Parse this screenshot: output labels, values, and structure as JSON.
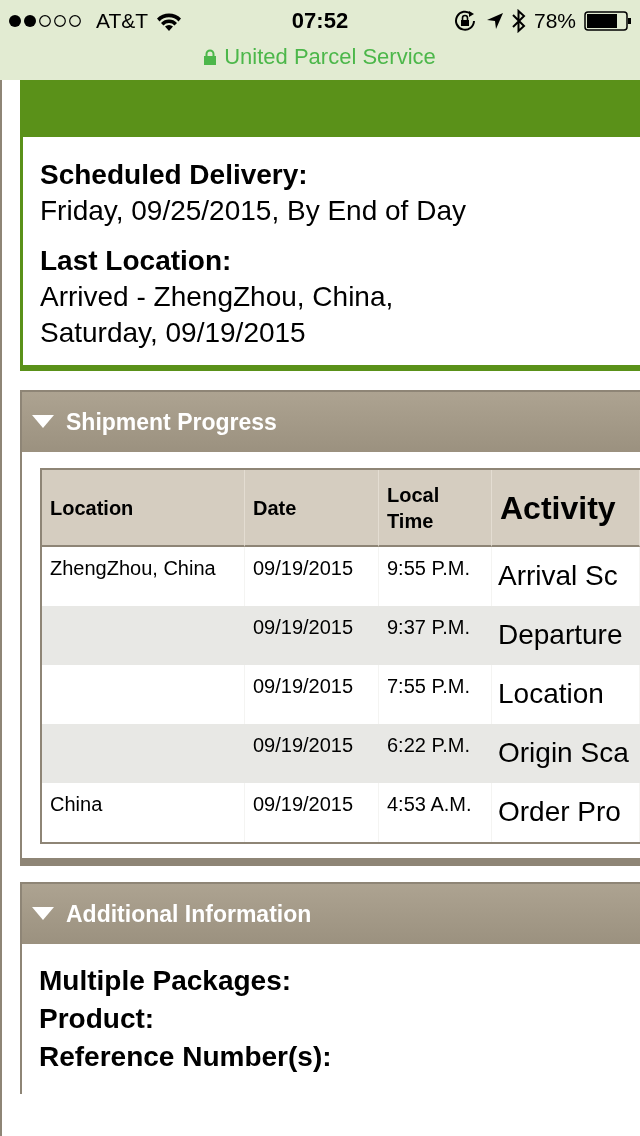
{
  "status_bar": {
    "carrier": "AT&T",
    "time": "07:52",
    "battery": "78%"
  },
  "address_bar": {
    "title": "United Parcel Service",
    "secure": true
  },
  "delivery": {
    "fields": [
      {
        "label": "Scheduled Delivery:",
        "lines": [
          "Friday, 09/25/2015, By End of Day"
        ]
      },
      {
        "label": "Last Location:",
        "lines": [
          "Arrived - ZhengZhou, China,",
          "Saturday, 09/19/2015"
        ]
      }
    ]
  },
  "shipment_progress": {
    "title": "Shipment Progress",
    "expanded": true,
    "columns": [
      "Location",
      "Date",
      "Local Time",
      "Activity"
    ],
    "rows": [
      {
        "location": "ZhengZhou, China",
        "date": "09/19/2015",
        "time": "9:55 P.M.",
        "activity": "Arrival Sc"
      },
      {
        "date": "09/19/2015",
        "time": "9:37 P.M.",
        "activity": "Departure"
      },
      {
        "date": "09/19/2015",
        "time": "7:55 P.M.",
        "activity": "Location"
      },
      {
        "date": "09/19/2015",
        "time": "6:22 P.M.",
        "activity": "Origin Sca"
      },
      {
        "location": "China",
        "date": "09/19/2015",
        "time": "4:53 A.M.",
        "activity": "Order Pro"
      }
    ]
  },
  "additional_information": {
    "title": "Additional Information",
    "expanded": true,
    "labels": [
      "Multiple Packages:",
      "Product:",
      "Reference Number(s):"
    ]
  }
}
